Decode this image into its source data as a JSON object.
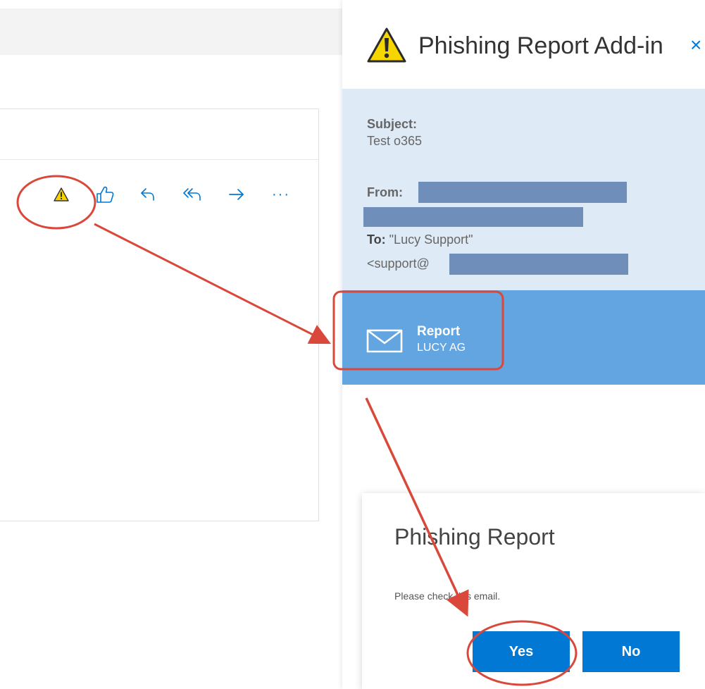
{
  "mail_toolbar": {
    "items": [
      {
        "name": "report-phishing",
        "icon": "warning-triangle-icon"
      },
      {
        "name": "like",
        "icon": "thumbs-up-icon"
      },
      {
        "name": "reply",
        "icon": "reply-icon"
      },
      {
        "name": "reply-all",
        "icon": "reply-all-icon"
      },
      {
        "name": "forward",
        "icon": "forward-arrow-icon"
      },
      {
        "name": "more",
        "label": "···"
      }
    ]
  },
  "addin": {
    "title": "Phishing Report Add-in",
    "close_label": "×",
    "subject_label": "Subject:",
    "subject_value": "Test o365",
    "from_label": "From:",
    "to_label": "To:",
    "to_value": "\"Lucy Support\"",
    "support_prefix": "<support@",
    "report_button": {
      "label": "Report",
      "sublabel": "LUCY AG",
      "icon": "envelope-icon"
    }
  },
  "dialog": {
    "title": "Phishing Report",
    "message": "Please check this email.",
    "yes_label": "Yes",
    "no_label": "No"
  },
  "colors": {
    "accent": "#0078d4",
    "info_bg": "#deebf7",
    "report_band": "#62a5e1",
    "redaction": "#6f8fba",
    "annotation": "#d9483b",
    "warning": "#f5d300"
  }
}
